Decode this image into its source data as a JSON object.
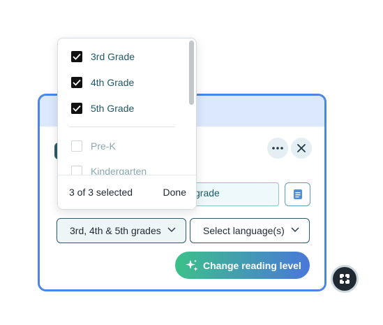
{
  "dropdown": {
    "options": [
      {
        "label": "3rd Grade",
        "checked": true
      },
      {
        "label": "4th Grade",
        "checked": true
      },
      {
        "label": "5th Grade",
        "checked": true
      },
      {
        "label": "Pre-K",
        "checked": false
      },
      {
        "label": "Kindergarten",
        "checked": false
      }
    ],
    "selected_count": "3 of 3 selected",
    "done_label": "Done"
  },
  "form": {
    "grade_field_value": "grade",
    "grade_select_value": "3rd, 4th & 5th grades",
    "language_select_placeholder": "Select language(s)",
    "change_level_label": "Change reading level"
  },
  "header": {
    "more_icon": "more-horizontal-icon",
    "close_icon": "close-icon"
  },
  "colors": {
    "accent_border": "#4b86e6",
    "header_bg": "#dbe8fd",
    "button_gradient_start": "#3cc08a",
    "button_gradient_end": "#4a78d9"
  }
}
